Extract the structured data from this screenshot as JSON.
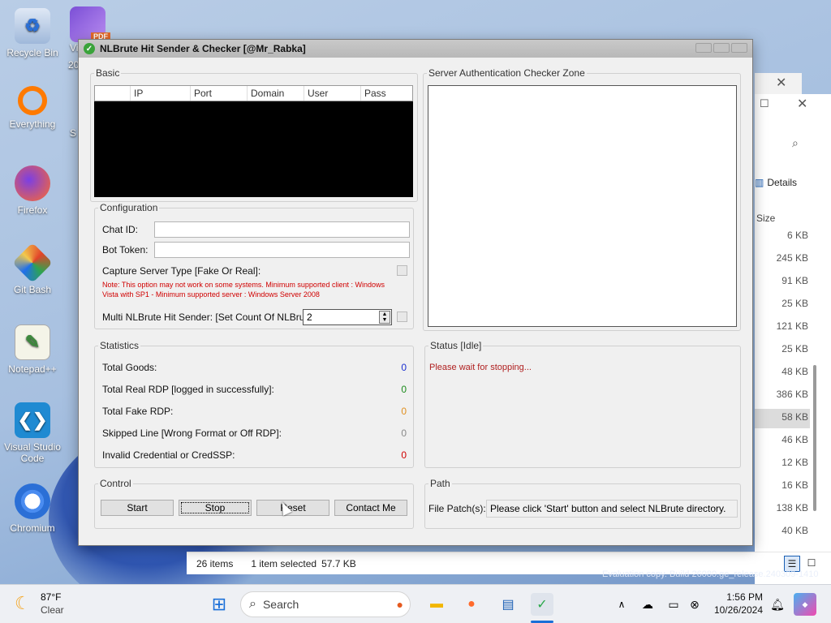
{
  "desktop": {
    "icons": [
      {
        "label": "Recycle Bin",
        "glyph": "recycle-bin-icon"
      },
      {
        "label": "Everything",
        "glyph": "everything-icon"
      },
      {
        "label": "Firefox",
        "glyph": "firefox-icon"
      },
      {
        "label": "Git Bash",
        "glyph": "git-bash-icon"
      },
      {
        "label": "Notepad++",
        "glyph": "notepadpp-icon"
      },
      {
        "label": "Visual Studio Code",
        "glyph": "vscode-icon"
      },
      {
        "label": "Chromium",
        "glyph": "chromium-icon"
      }
    ],
    "partial_icon_label_1": "Vi",
    "partial_icon_label_2": "20",
    "partial_icon_label_3": "S",
    "partial_badge": "PDF"
  },
  "explorer": {
    "details_label": "Details",
    "size_header": "Size",
    "sizes": [
      "6 KB",
      "245 KB",
      "91 KB",
      "25 KB",
      "121 KB",
      "25 KB",
      "48 KB",
      "386 KB",
      "58 KB",
      "46 KB",
      "12 KB",
      "16 KB",
      "138 KB",
      "40 KB"
    ],
    "items_count": "26 items",
    "selected": "1 item selected",
    "selected_size": "57.7 KB"
  },
  "window": {
    "title": "NLBrute Hit Sender & Checker [@Mr_Rabka]",
    "basic": {
      "label": "Basic",
      "columns": [
        "IP",
        "Port",
        "Domain",
        "User",
        "Pass"
      ]
    },
    "config": {
      "label": "Configuration",
      "chat_id_label": "Chat ID:",
      "chat_id_value": "",
      "bot_token_label": "Bot Token:",
      "bot_token_value": "",
      "capture_label": "Capture Server Type [Fake Or Real]:",
      "note": "Note: This option may not work on some systems. Minimum supported client : Windows Vista with SP1 - Minimum supported server : Windows Server 2008",
      "multi_label": "Multi NLBrute Hit Sender: [Set Count Of NLBrute]:",
      "multi_value": "2"
    },
    "stats": {
      "label": "Statistics",
      "rows": [
        {
          "label": "Total Goods:",
          "value": "0",
          "color": "#1a2fd0"
        },
        {
          "label": "Total Real RDP [logged in successfully]:",
          "value": "0",
          "color": "#1a8a1a"
        },
        {
          "label": "Total Fake RDP:",
          "value": "0",
          "color": "#e09020"
        },
        {
          "label": "Skipped Line [Wrong Format or Off RDP]:",
          "value": "0",
          "color": "#888888"
        },
        {
          "label": "Invalid Credential or CredSSP:",
          "value": "0",
          "color": "#d00000"
        }
      ]
    },
    "control": {
      "label": "Control",
      "start": "Start",
      "stop": "Stop",
      "reset": "Reset",
      "contact": "Contact Me"
    },
    "server_zone": {
      "label": "Server Authentication Checker Zone"
    },
    "status": {
      "label": "Status [Idle]",
      "message": "Please wait for stopping..."
    },
    "path": {
      "label": "Path",
      "file_label": "File Patch(s):",
      "file_value": "Please click 'Start' button and select NLBrute directory."
    }
  },
  "taskbar": {
    "weather_temp": "87°F",
    "weather_desc": "Clear",
    "search_placeholder": "Search",
    "time": "1:56 PM",
    "date": "10/26/2024",
    "watermark": "Evaluation copy. Build 26080.ge_release.240309-1410"
  }
}
